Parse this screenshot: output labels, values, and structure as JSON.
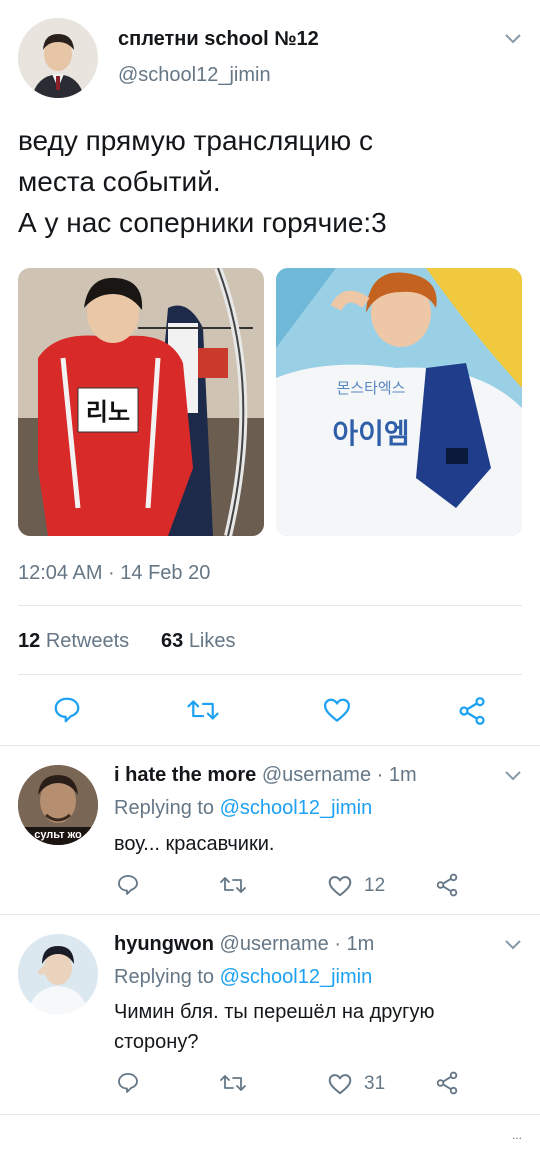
{
  "tweet": {
    "display_name": "сплетни school №12",
    "handle": "@school12_jimin",
    "text_line1": "веду прямую трансляцию с",
    "text_line2": "места событий.",
    "text_line3": "А у нас соперники горячие:3",
    "images": [
      {
        "name_tag": "리노",
        "description": "archer in red tracksuit"
      },
      {
        "name_tag": "아이엠",
        "vest_text": "몬스타엑스",
        "description": "archer in white shirt with blue vest"
      }
    ],
    "timestamp": "12:04 AM · 14 Feb 20",
    "retweets_count": "12",
    "retweets_label": "Retweets",
    "likes_count": "63",
    "likes_label": "Likes"
  },
  "replies": [
    {
      "name": "i hate the more",
      "meta": "@username · 1m",
      "replying_prefix": "Replying to",
      "replying_to": "@school12_jimin",
      "text_line1": "воу... красавчики.",
      "text_line2": "",
      "avatar_caption": "сульт жо",
      "like_count": "12"
    },
    {
      "name": "hyungwon",
      "meta": "@username · 1m",
      "replying_prefix": "Replying to",
      "replying_to": "@school12_jimin",
      "text_line1": "Чимин бля. ты перешёл на другую",
      "text_line2": "сторону?",
      "avatar_caption": "",
      "like_count": "31"
    }
  ],
  "footer": {
    "more_dots": "..."
  },
  "colors": {
    "accent": "#1da1f2",
    "muted": "#657786",
    "icon": "#1da1f2",
    "divider": "#e1e8ed"
  }
}
